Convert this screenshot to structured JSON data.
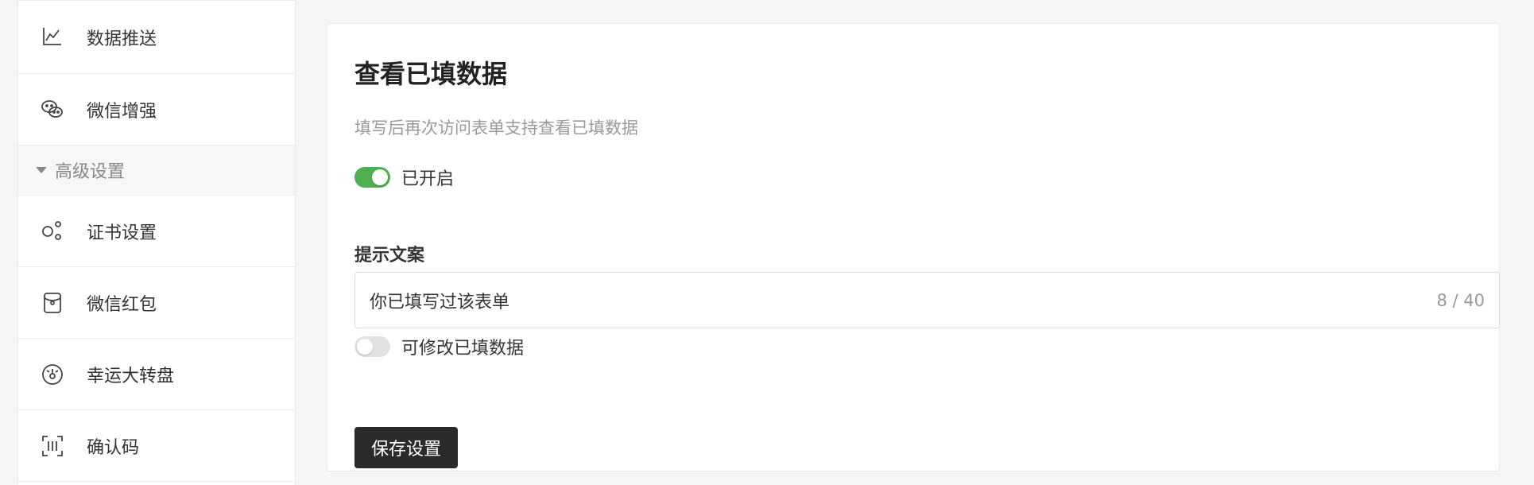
{
  "sidebar": {
    "items_top": [
      {
        "label": "数据推送",
        "icon": "line-chart-icon"
      },
      {
        "label": "微信增强",
        "icon": "wechat-icon"
      }
    ],
    "section_header": "高级设置",
    "items_bottom": [
      {
        "label": "证书设置",
        "icon": "certificate-icon"
      },
      {
        "label": "微信红包",
        "icon": "red-packet-icon"
      },
      {
        "label": "幸运大转盘",
        "icon": "lucky-wheel-icon"
      },
      {
        "label": "确认码",
        "icon": "scan-code-icon"
      }
    ]
  },
  "panel": {
    "title": "查看已填数据",
    "description": "填写后再次访问表单支持查看已填数据",
    "toggle_main": {
      "label": "已开启",
      "on": true
    },
    "prompt_label": "提示文案",
    "prompt_value": "你已填写过该表单",
    "prompt_counter": "8 / 40",
    "toggle_edit": {
      "label": "可修改已填数据",
      "on": false
    },
    "save_label": "保存设置"
  },
  "colors": {
    "toggle_on": "#4caf50",
    "toggle_off": "#e2e2e2",
    "button_bg": "#2b2b2b"
  }
}
